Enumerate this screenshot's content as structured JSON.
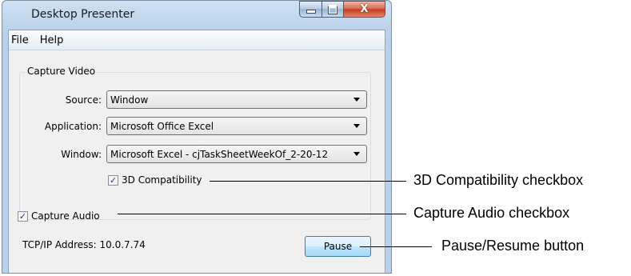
{
  "window": {
    "title": "Desktop Presenter",
    "close_glyph": "X"
  },
  "menu": [
    "File",
    "Help"
  ],
  "capture_video": {
    "legend": "Capture Video",
    "source_label": "Source:",
    "source_value": "Window",
    "application_label": "Application:",
    "application_value": "Microsoft Office Excel",
    "window_label": "Window:",
    "window_value": "Microsoft Excel - cjTaskSheetWeekOf_2-20-12",
    "compat_label": "3D Compatibility",
    "compat_checked": true
  },
  "capture_audio": {
    "label": "Capture Audio",
    "checked": true
  },
  "tcp": {
    "text": "TCP/IP Address:  10.0.7.74"
  },
  "pause_button": "Pause",
  "callouts": {
    "compat": "3D Compatibility checkbox",
    "audio": "Capture Audio checkbox",
    "pause": "Pause/Resume button"
  },
  "check_glyph": "✓"
}
